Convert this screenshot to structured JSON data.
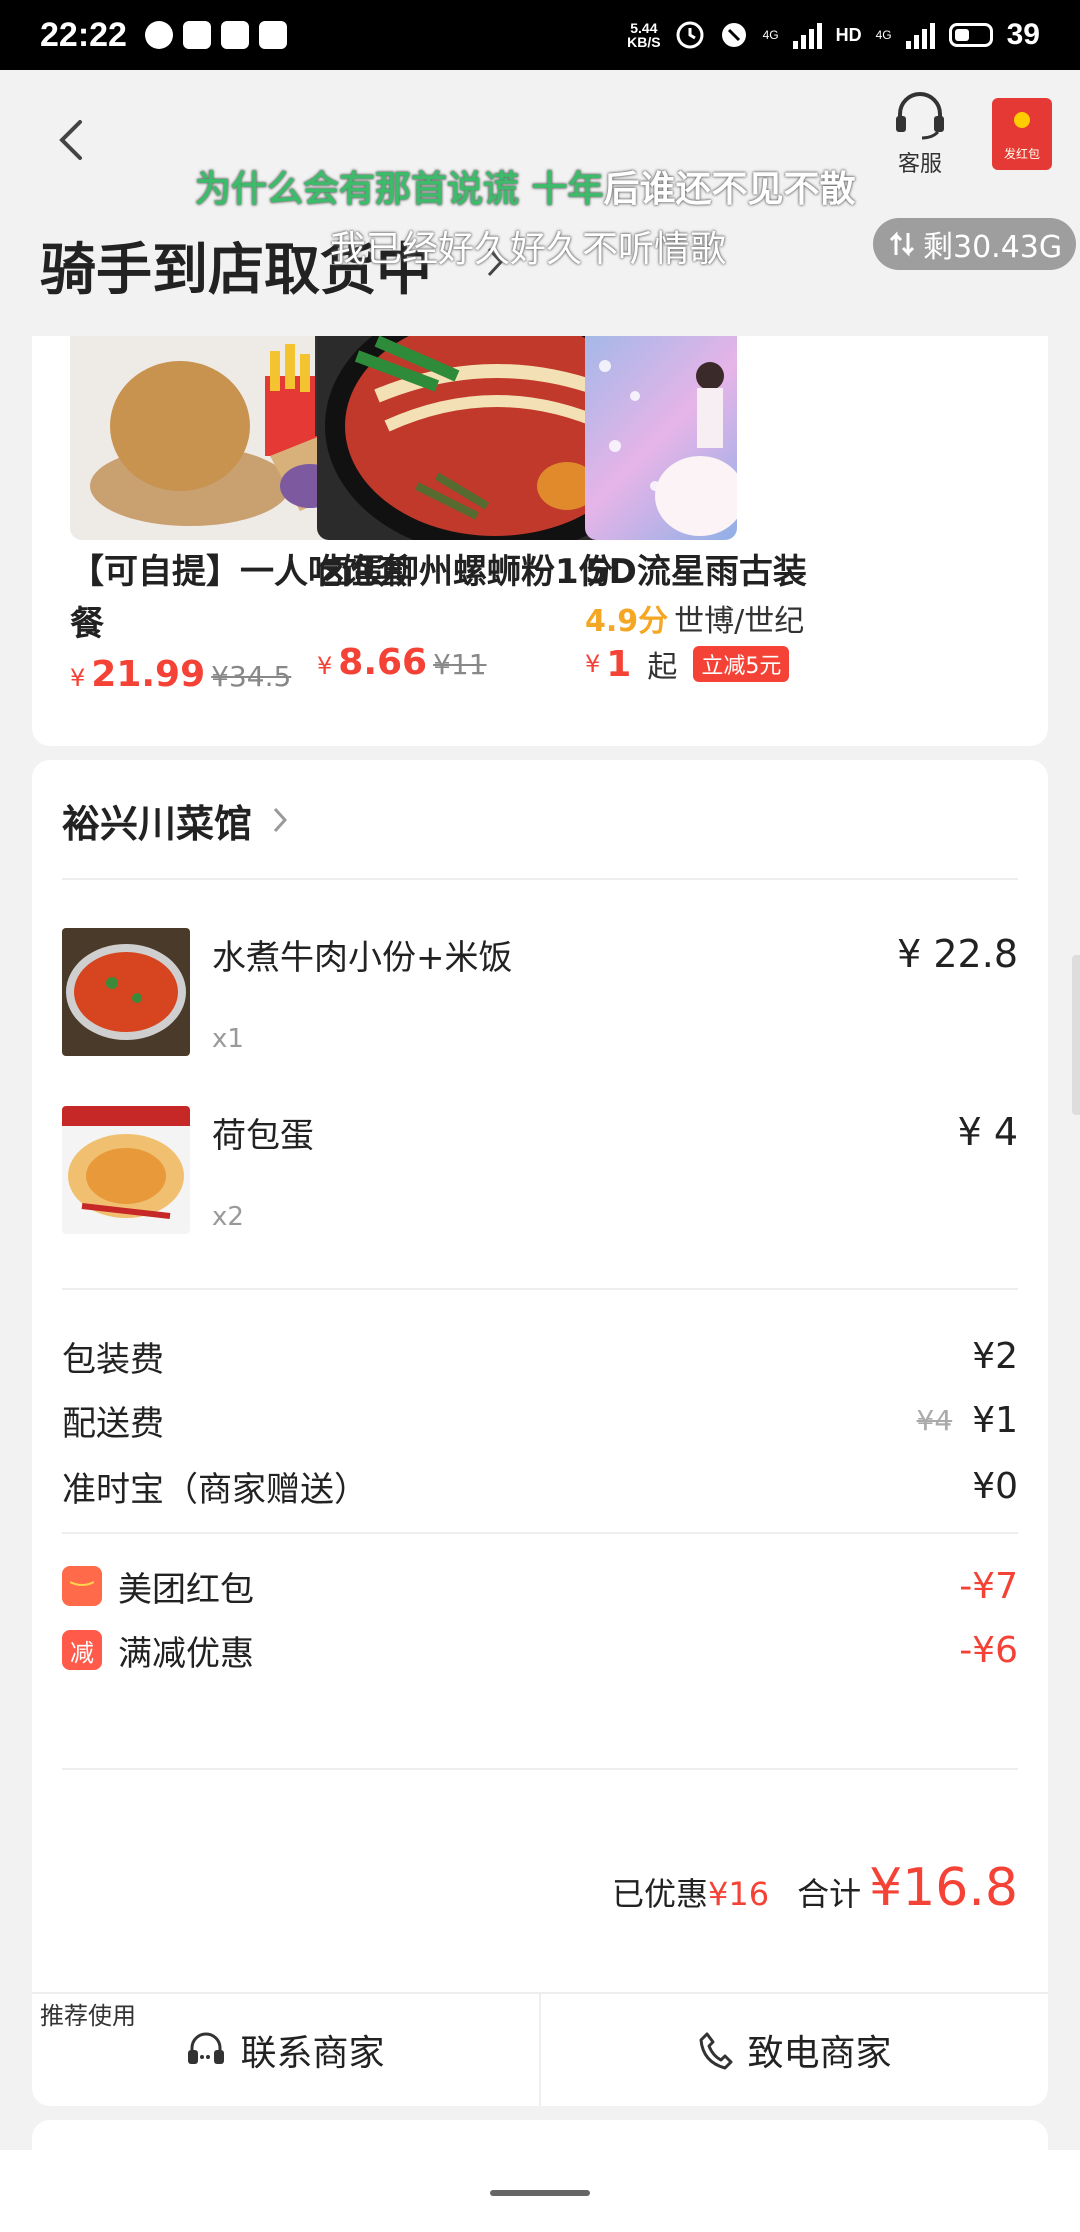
{
  "status_bar": {
    "time": "22:22",
    "net_speed_value": "5.44",
    "net_speed_unit": "KB/S",
    "net_type_1": "4G",
    "hd": "HD",
    "net_type_2": "4G",
    "battery": "39"
  },
  "header": {
    "customer_service": "客服",
    "red_packet": "发红包",
    "order_status": "骑手到店取货中",
    "data_remaining": "剩30.43G"
  },
  "lyrics": {
    "line1_highlight": "为什么会有那首说谎 十年",
    "line1_rest": "后谁还不见不散",
    "line2": "我已经好久好久不听情歌"
  },
  "recommendations": [
    {
      "title": "【可自提】一人吃饱套餐",
      "currency": "¥",
      "price": "21.99",
      "original": "¥34.5"
    },
    {
      "title": "卤蛋柳州螺蛳粉1份",
      "currency": "¥",
      "price": "8.66",
      "original": "¥11"
    },
    {
      "title": "5D流星雨古装",
      "rating": "4.9分",
      "location": "世博/世纪",
      "currency": "¥",
      "price": "1",
      "suffix": "起",
      "tag": "立减5元"
    }
  ],
  "order": {
    "shop_name": "裕兴川菜馆",
    "items": [
      {
        "name": "水煮牛肉小份+米饭",
        "qty": "x1",
        "price": "¥ 22.8"
      },
      {
        "name": "荷包蛋",
        "qty": "x2",
        "price": "¥ 4"
      }
    ],
    "fees": {
      "packaging_label": "包装费",
      "packaging": "¥2",
      "delivery_label": "配送费",
      "delivery_original": "¥4",
      "delivery": "¥1",
      "ontime_label": "准时宝（商家赠送）",
      "ontime": "¥0"
    },
    "discounts": {
      "redpacket_label": "美团红包",
      "redpacket": "-¥7",
      "reduction_icon": "减",
      "reduction_label": "满减优惠",
      "reduction": "-¥6"
    },
    "total": {
      "discount_label": "已优惠",
      "discount": "¥16",
      "total_label": "合计",
      "total": "¥16.8"
    }
  },
  "actions": {
    "recommend_tag": "推荐使用",
    "contact": "联系商家",
    "call": "致电商家"
  },
  "colors": {
    "accent_red": "#f44336",
    "rating_orange": "#f5a623",
    "lyric_green": "#3dbb6b"
  }
}
